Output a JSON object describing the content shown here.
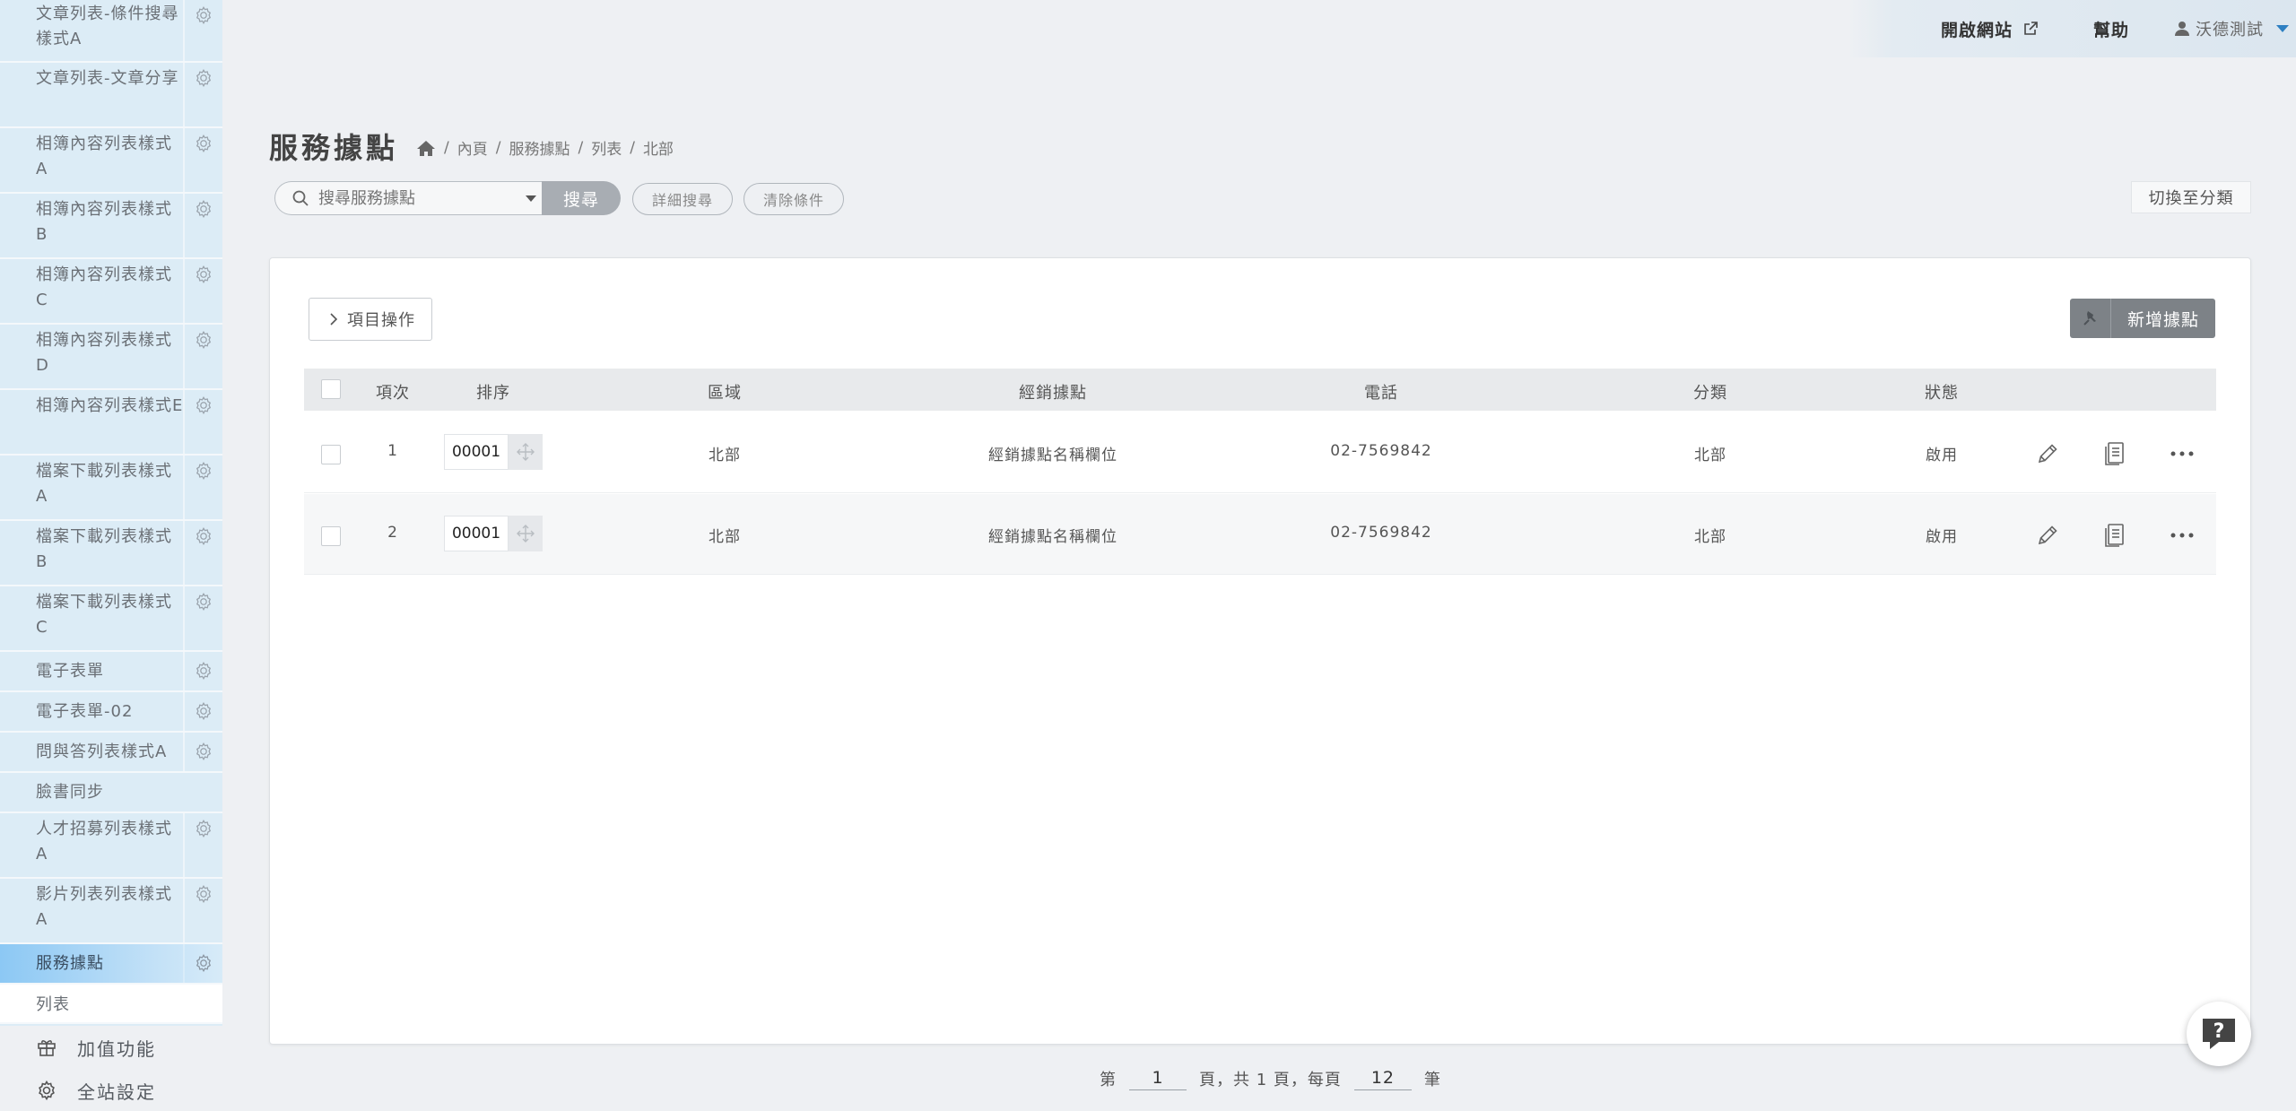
{
  "sidebar": {
    "items": [
      {
        "label": "文章列表-條件搜尋樣式A"
      },
      {
        "label": "文章列表-文章分享"
      },
      {
        "label": "相簿內容列表樣式A"
      },
      {
        "label": "相簿內容列表樣式B"
      },
      {
        "label": "相簿內容列表樣式C"
      },
      {
        "label": "相簿內容列表樣式D"
      },
      {
        "label": "相簿內容列表樣式E"
      },
      {
        "label": "檔案下載列表樣式A"
      },
      {
        "label": "檔案下載列表樣式B"
      },
      {
        "label": "檔案下載列表樣式C"
      },
      {
        "label": "電子表單"
      },
      {
        "label": "電子表單-02"
      },
      {
        "label": "問與答列表樣式A"
      },
      {
        "label": "臉書同步"
      },
      {
        "label": "人才招募列表樣式A"
      },
      {
        "label": "影片列表列表樣式A"
      },
      {
        "label": "服務據點"
      }
    ],
    "active_sub": "列表",
    "extra": [
      {
        "label": "加值功能",
        "icon": "gift-icon"
      },
      {
        "label": "全站設定",
        "icon": "settings-icon"
      }
    ]
  },
  "topbar": {
    "open_site": "開啟網站",
    "help": "幫助",
    "user": "沃德測試"
  },
  "header": {
    "title": "服務據點",
    "breadcrumb": [
      "內頁",
      "服務據點",
      "列表",
      "北部"
    ]
  },
  "search": {
    "placeholder": "搜尋服務據點",
    "button": "搜尋",
    "advanced": "詳細搜尋",
    "clear": "清除條件",
    "switch": "切換至分類"
  },
  "toolbar": {
    "ops": "項目操作",
    "add": "新增據點"
  },
  "table": {
    "columns": [
      "項次",
      "排序",
      "區域",
      "經銷據點",
      "電話",
      "分類",
      "狀態"
    ],
    "rows": [
      {
        "index": "1",
        "order": "00001",
        "region": "北部",
        "dealer": "經銷據點名稱欄位",
        "phone": "02-7569842",
        "category": "北部",
        "status": "啟用"
      },
      {
        "index": "2",
        "order": "00001",
        "region": "北部",
        "dealer": "經銷據點名稱欄位",
        "phone": "02-7569842",
        "category": "北部",
        "status": "啟用"
      }
    ]
  },
  "pagination": {
    "prefix": "第",
    "page": "1",
    "middle": "頁，共 1 頁，每頁",
    "per_page": "12",
    "suffix": "筆"
  },
  "colors": {
    "sidebar_bg": "#dcecf6",
    "sidebar_active": "#8cc8f4",
    "add_button": "#7d8287",
    "user_caret": "#2d7fc2"
  }
}
